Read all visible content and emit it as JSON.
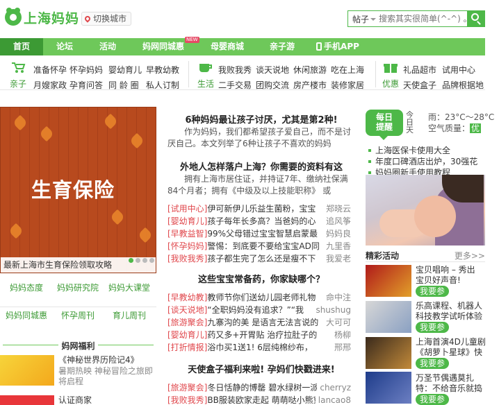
{
  "header": {
    "logo_text": "上海妈妈",
    "city_label": "切换城市",
    "search_category": "帖子",
    "search_placeholder": "搜索其实很简单(^-^) 。",
    "brand_color": "#4db848"
  },
  "nav": {
    "items": [
      "首页",
      "论坛",
      "活动",
      "妈网同城惠",
      "母婴商城",
      "亲子游",
      "手机APP"
    ],
    "active_index": 0,
    "new_badge": "NEW"
  },
  "subnav": {
    "groups": [
      {
        "label": "亲子",
        "row1": [
          "准备怀孕",
          "怀孕妈妈",
          "婴幼育儿",
          "早教幼教"
        ],
        "row2": [
          "月嫂家政",
          "孕育问答",
          "同 龄 圈",
          "私人订制"
        ]
      },
      {
        "label": "生活",
        "row1": [
          "我败我秀",
          "谈天说地",
          "休闲旅游",
          "吃在上海"
        ],
        "row2": [
          "二手交易",
          "团购交流",
          "房产楼市",
          "装修家居"
        ]
      },
      {
        "label": "优惠",
        "row1": [
          "礼品超市",
          "试用中心"
        ],
        "row2": [
          "天使盒子",
          "品牌根据地"
        ]
      }
    ]
  },
  "banner": {
    "title": "生育保险",
    "caption": "最新上海市生育保险领取攻略"
  },
  "grid_links": [
    [
      "妈妈态度",
      "妈妈研究院",
      "妈妈大课堂"
    ],
    [
      "妈妈同城惠",
      "怀孕周刊",
      "育儿周刊"
    ]
  ],
  "welfare": {
    "title": "妈网福利",
    "items": [
      {
        "title": "《神秘世界历险记4》",
        "desc1": "暑期热映  神秘冒险之旅即",
        "desc2": "将启程"
      },
      {
        "title": "认证商家"
      }
    ]
  },
  "middle": {
    "h1": "6种妈妈最让孩子讨厌，尤其是第2种!",
    "p1": "作为妈妈，我们都希望孩子爱自己，而不是讨厌自己。本文列举了6种让孩子不喜欢的妈妈",
    "h2": "外地人怎样落户上海？你需要的资料有这",
    "p2": "拥有上海市居住证，并持证7年、缴纳社保满84个月者；拥有《中级及以上技能职称》 或",
    "list1": [
      {
        "tag": "[试用中心]",
        "text": "伊可新伊儿乐益生菌粉，宝宝",
        "user": "郑晓云"
      },
      {
        "tag": "[婴幼育儿]",
        "text": "孩子每年长多高？当爸妈的心",
        "user": "追风筝"
      },
      {
        "tag": "[早教益智]",
        "text": "99%父母错过宝宝智慧启蒙最",
        "user": "妈妈良"
      },
      {
        "tag": "[怀孕妈妈]",
        "text": "警惕：到底要不要给宝宝AD同",
        "user": "九里香"
      },
      {
        "tag": "[我败我秀]",
        "text": "孩子都生完了怎么还是瘦不下",
        "user": "我爱老"
      }
    ],
    "h3": "这些宝宝常备药，你家缺哪个？",
    "list2": [
      {
        "tag": "[早教幼教]",
        "text": "教师节你们送幼儿园老师礼物",
        "user": "命中注"
      },
      {
        "tag": "[谈天说地]",
        "text": "“全职妈妈没有追求？”“我",
        "user": "shushug"
      },
      {
        "tag": "[旅游聚会]",
        "text": "九寨沟的美 是语言无法言说的",
        "user": "大可可"
      },
      {
        "tag": "[婴幼育儿]",
        "text": "药又多+开胃贴 治疗拉肚子的",
        "user": "杨柳"
      },
      {
        "tag": "[打折情报]",
        "text": "浴巾买1送1! 6层纯棉纱布，",
        "user": "邢邢"
      }
    ],
    "h4": "天使盒子福利来啦! 孕妈们快戳进来!",
    "list3": [
      {
        "tag": "[旅游聚会]",
        "text": "冬日恬静的博罄 碧水绿树一派",
        "user": "cherryz"
      },
      {
        "tag": "[我败我秀]",
        "text": "BB服装欧家走起 萌萌哒小熊穿",
        "user": "lancao8"
      }
    ]
  },
  "right": {
    "daily_label_1": "每日",
    "daily_label_2": "提醒",
    "weather_img_alt": "今日天气",
    "weather_text": "雨：23°C～28°C",
    "air_label": "空气质量：",
    "air_value": "优",
    "reminders": [
      "上海医保卡使用大全",
      "年度口碑酒店出炉，30强花",
      "妈妈圈新手使用教程"
    ],
    "activity_title": "精彩活动",
    "more_label": "更多>>",
    "activities": [
      {
        "title1": "宝贝唱响 – 秀出",
        "title2": "宝贝好声音!",
        "btn": "我要参"
      },
      {
        "title1": "乐高课程、机器人",
        "title2": "科技教学试听体验",
        "btn": "我要参"
      },
      {
        "title1": "上海首演4D儿童剧",
        "title2": "《胡萝卜星球》快",
        "btn": "我要参"
      },
      {
        "title1": "万圣节偶遇莫扎",
        "title2": "特：不给音乐就捣",
        "btn": "我要参"
      }
    ]
  }
}
